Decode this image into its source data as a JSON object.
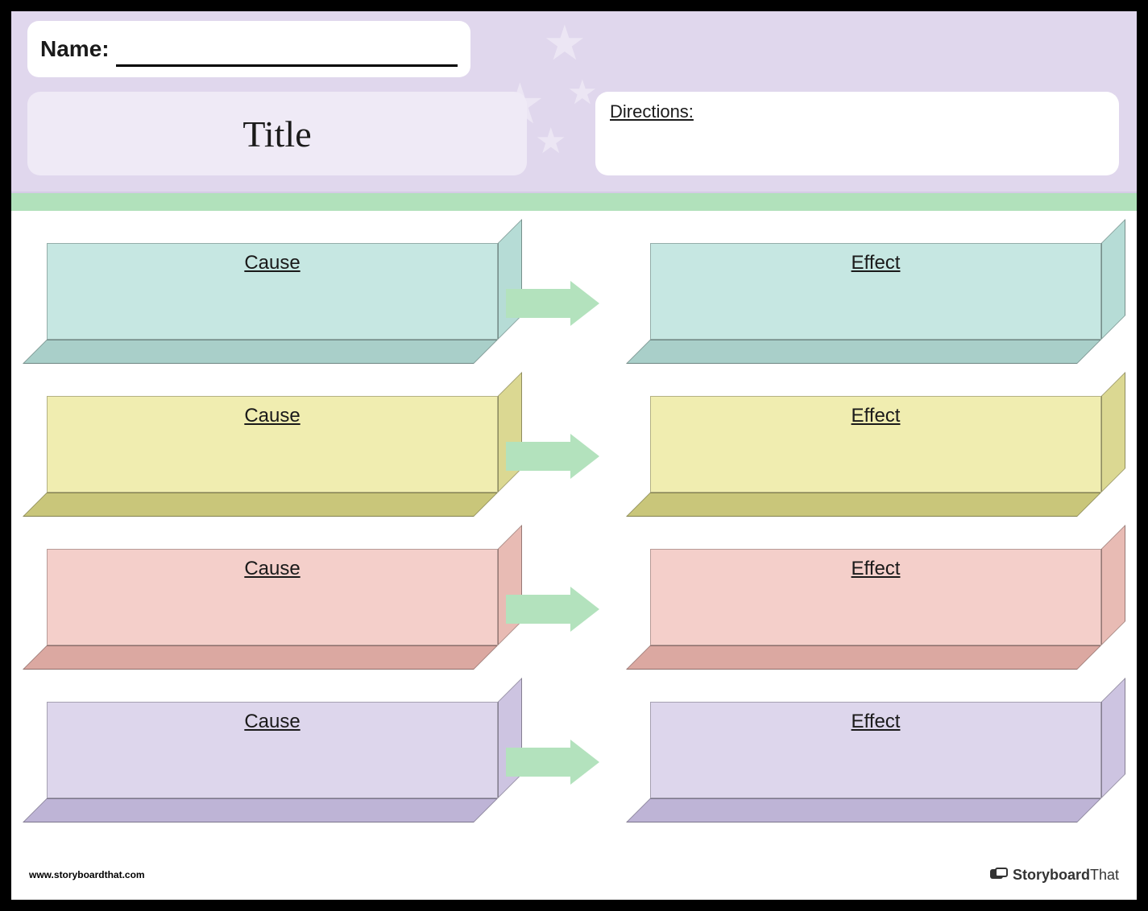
{
  "header": {
    "name_label": "Name:",
    "title": "Title",
    "directions_label": "Directions:"
  },
  "rows": [
    {
      "cause_label": "Cause",
      "effect_label": "Effect",
      "colors": {
        "front": "#c6e7e2",
        "side": "#a9cfc9",
        "cap": "#b6dcd6"
      }
    },
    {
      "cause_label": "Cause",
      "effect_label": "Effect",
      "colors": {
        "front": "#f0edb0",
        "side": "#c9c67a",
        "cap": "#dbd892"
      }
    },
    {
      "cause_label": "Cause",
      "effect_label": "Effect",
      "colors": {
        "front": "#f4cfca",
        "side": "#dba8a1",
        "cap": "#e8bbb4"
      }
    },
    {
      "cause_label": "Cause",
      "effect_label": "Effect",
      "colors": {
        "front": "#ddd6ec",
        "side": "#beb4d6",
        "cap": "#cdc4e1"
      }
    }
  ],
  "footer": {
    "url": "www.storyboardthat.com",
    "brand_bold": "Storyboard",
    "brand_light": "That"
  }
}
